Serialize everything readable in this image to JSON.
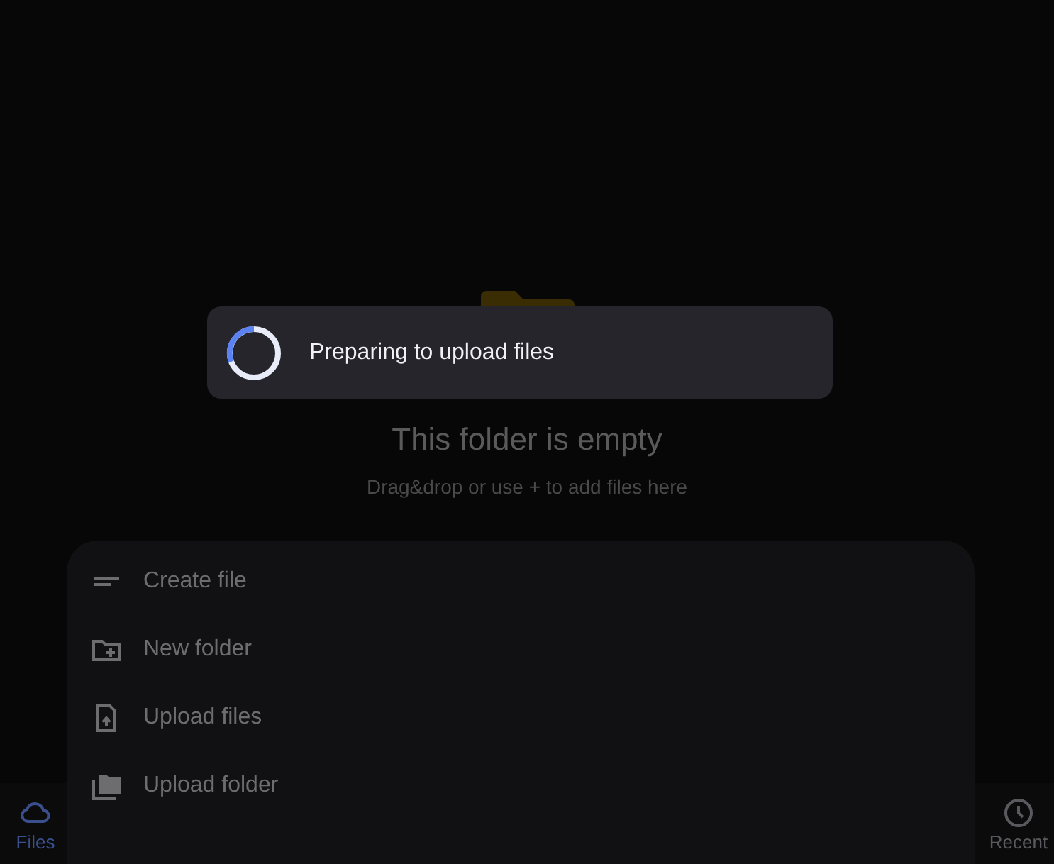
{
  "empty_state": {
    "title": "This folder is empty",
    "subtitle": "Drag&drop or use + to add files here"
  },
  "toast": {
    "message": "Preparing to upload files"
  },
  "bottom_nav": [
    {
      "label": "Files",
      "selected": true
    },
    {
      "label": "Recent",
      "selected": false
    }
  ],
  "sheet": {
    "items": [
      {
        "label": "Create file"
      },
      {
        "label": "New folder"
      },
      {
        "label": "Upload files"
      },
      {
        "label": "Upload folder"
      }
    ]
  }
}
